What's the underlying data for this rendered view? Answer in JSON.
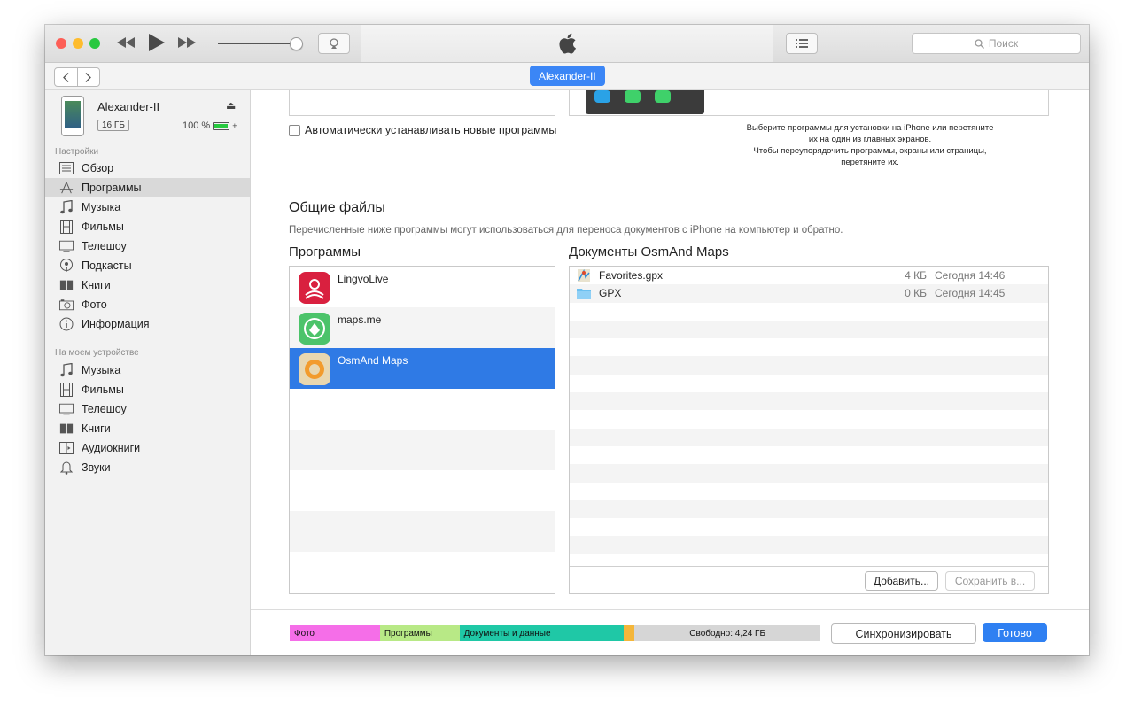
{
  "titlebar": {
    "search_placeholder": "Поиск",
    "device_badge": "Alexander-II"
  },
  "device": {
    "name": "Alexander-II",
    "capacity": "16 ГБ",
    "battery": "100 %"
  },
  "sidebar": {
    "settings_header": "Настройки",
    "settings_items": [
      {
        "label": "Обзор",
        "icon": "summary-icon"
      },
      {
        "label": "Программы",
        "icon": "apps-icon",
        "selected": true
      },
      {
        "label": "Музыка",
        "icon": "music-note-icon"
      },
      {
        "label": "Фильмы",
        "icon": "film-icon"
      },
      {
        "label": "Телешоу",
        "icon": "tv-icon"
      },
      {
        "label": "Подкасты",
        "icon": "podcast-icon"
      },
      {
        "label": "Книги",
        "icon": "book-icon"
      },
      {
        "label": "Фото",
        "icon": "camera-icon"
      },
      {
        "label": "Информация",
        "icon": "info-icon"
      }
    ],
    "device_header": "На моем устройстве",
    "device_items": [
      {
        "label": "Музыка",
        "icon": "music-note-icon"
      },
      {
        "label": "Фильмы",
        "icon": "film-icon"
      },
      {
        "label": "Телешоу",
        "icon": "tv-icon"
      },
      {
        "label": "Книги",
        "icon": "book-icon"
      },
      {
        "label": "Аудиокниги",
        "icon": "audiobook-icon"
      },
      {
        "label": "Звуки",
        "icon": "bell-icon"
      }
    ]
  },
  "main": {
    "auto_install_label": "Автоматически устанавливать новые программы",
    "hint_line1": "Выберите программы для установки на iPhone или перетяните",
    "hint_line2": "их на один из главных экранов.",
    "hint_line3": "Чтобы переупорядочить программы, экраны или страницы,",
    "hint_line4": "перетяните их.",
    "shared_files_title": "Общие файлы",
    "shared_files_desc": "Перечисленные ниже программы могут использоваться для переноса документов с iPhone на компьютер и обратно.",
    "apps_header": "Программы",
    "docs_header": "Документы OsmAnd Maps",
    "apps": [
      {
        "name": "LingvoLive",
        "icon": "lingvolive-app-icon",
        "color": "#d9203f"
      },
      {
        "name": "maps.me",
        "icon": "mapsme-app-icon",
        "color": "#4cc36a"
      },
      {
        "name": "OsmAnd Maps",
        "icon": "osmand-app-icon",
        "color": "#f29b2c",
        "selected": true
      }
    ],
    "documents": [
      {
        "name": "Favorites.gpx",
        "size": "4 КБ",
        "date": "Сегодня 14:46",
        "icon": "map-file-icon"
      },
      {
        "name": "GPX",
        "size": "0 КБ",
        "date": "Сегодня 14:45",
        "icon": "folder-icon"
      }
    ],
    "add_button": "Добавить...",
    "save_button": "Сохранить в..."
  },
  "footer": {
    "capacity_segments": [
      {
        "label": "Фото",
        "color": "#f56ee8",
        "fraction": 0.17
      },
      {
        "label": "Программы",
        "color": "#b8e986",
        "fraction": 0.15
      },
      {
        "label": "Документы и данные",
        "color": "#1fc8a6",
        "fraction": 0.31
      },
      {
        "label": "",
        "color": "#f4b63a",
        "fraction": 0.02
      },
      {
        "label": "Свободно: 4,24 ГБ",
        "color": "#d6d6d6",
        "fraction": 0.35
      }
    ],
    "sync_button": "Синхронизировать",
    "done_button": "Готово"
  }
}
